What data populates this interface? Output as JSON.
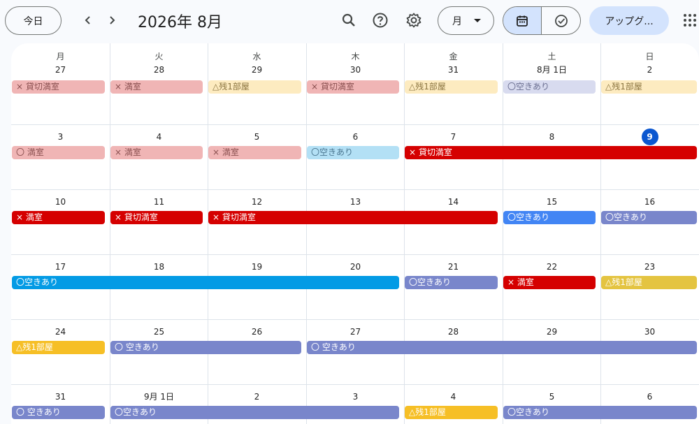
{
  "header": {
    "today_label": "今日",
    "title": "2026年 8月",
    "view_label": "月",
    "upgrade_label": "アップグ..."
  },
  "weekdays": [
    "月",
    "火",
    "水",
    "木",
    "金",
    "土",
    "日"
  ],
  "weeks": [
    [
      "27",
      "28",
      "29",
      "30",
      "31",
      "8月 1日",
      "2"
    ],
    [
      "3",
      "4",
      "5",
      "6",
      "7",
      "8",
      "9"
    ],
    [
      "10",
      "11",
      "12",
      "13",
      "14",
      "15",
      "16"
    ],
    [
      "17",
      "18",
      "19",
      "20",
      "21",
      "22",
      "23"
    ],
    [
      "24",
      "25",
      "26",
      "27",
      "28",
      "29",
      "30"
    ],
    [
      "31",
      "9月 1日",
      "2",
      "3",
      "4",
      "5",
      "6"
    ]
  ],
  "today": "9",
  "colors": {
    "red": "#d50000",
    "red_past": "#f0b5b5",
    "yellow": "#f6bf26",
    "yellow_past": "#fdebc0",
    "lavender": "#7986cb",
    "lavender_past": "#d8dbef",
    "blue_light": "#4285f4",
    "peacock": "#039be5",
    "peacock_past": "#b3e0f5",
    "mustard": "#e4c441",
    "today_circle": "#0b57d0"
  },
  "events": [
    {
      "label": "× 貸切満室"
    },
    {
      "label": "× 満室"
    },
    {
      "label": "△残1部屋"
    },
    {
      "label": "× 貸切満室"
    },
    {
      "label": "△残1部屋"
    },
    {
      "label": "〇空きあり"
    },
    {
      "label": "△残1部屋"
    },
    {
      "label": "〇 満室"
    },
    {
      "label": "× 満室"
    },
    {
      "label": "× 満室"
    },
    {
      "label": "〇空きあり"
    },
    {
      "label": "× 貸切満室"
    },
    {
      "label": "× 満室"
    },
    {
      "label": "× 貸切満室"
    },
    {
      "label": "× 貸切満室"
    },
    {
      "label": "〇空きあり"
    },
    {
      "label": "〇空きあり"
    },
    {
      "label": "〇空きあり"
    },
    {
      "label": "〇空きあり"
    },
    {
      "label": "× 満室"
    },
    {
      "label": "△残1部屋"
    },
    {
      "label": "△残1部屋"
    },
    {
      "label": "〇 空きあり"
    },
    {
      "label": "〇 空きあり"
    },
    {
      "label": "〇 空きあり"
    },
    {
      "label": "〇空きあり"
    },
    {
      "label": "△残1部屋"
    },
    {
      "label": "〇空きあり"
    }
  ]
}
